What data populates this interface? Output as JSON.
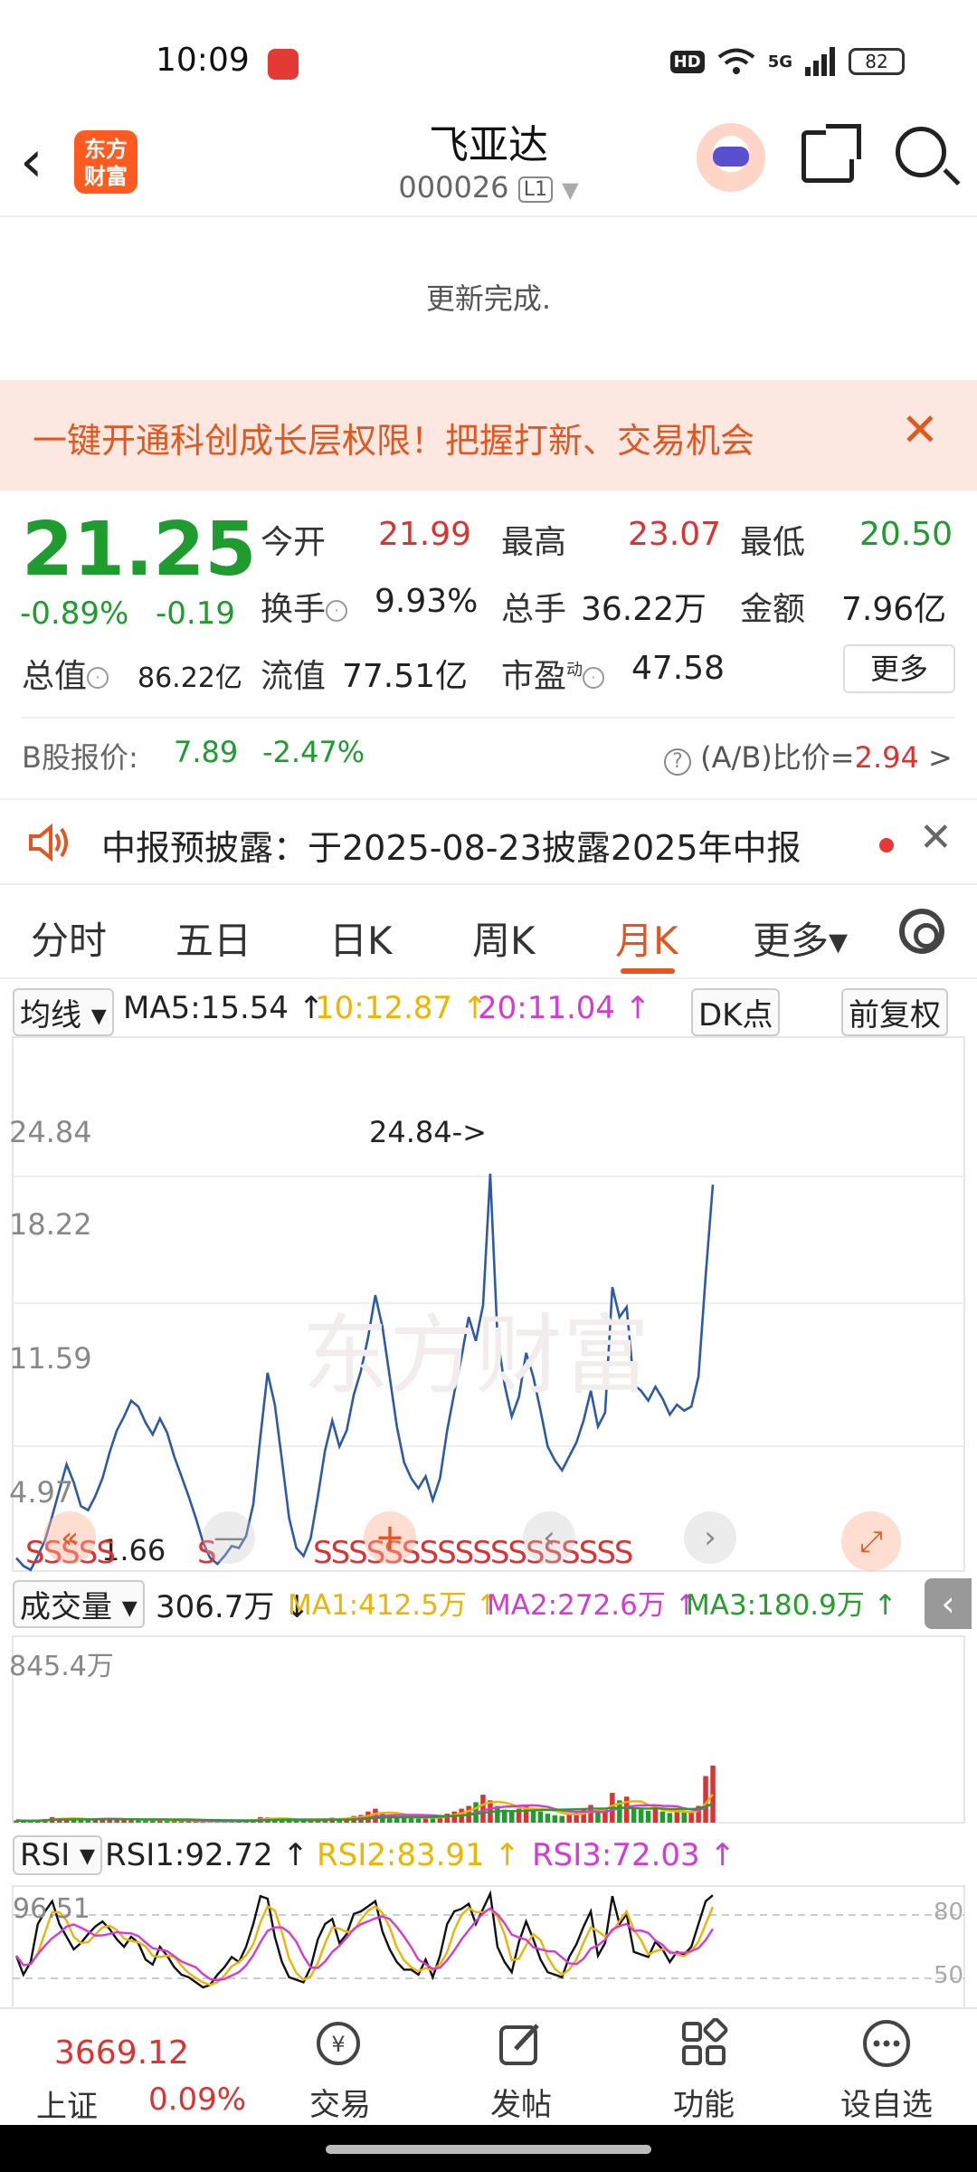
{
  "status": {
    "time": "10:09",
    "hd": "HD",
    "net": "5G",
    "battery": "82"
  },
  "header": {
    "logo_text": "东方\n财富",
    "name": "飞亚达",
    "code": "000026",
    "level": "L1"
  },
  "update_text": "更新完成.",
  "promo": {
    "text": "一键开通科创成长层权限！把握打新、交易机会"
  },
  "quote": {
    "price": "21.25",
    "change_pct": "-0.89%",
    "change": "-0.19",
    "open_label": "今开",
    "open": "21.99",
    "high_label": "最高",
    "high": "23.07",
    "low_label": "最低",
    "low": "20.50",
    "turnover_label": "换手",
    "turnover": "9.93%",
    "volume_label": "总手",
    "volume": "36.22万",
    "amount_label": "金额",
    "amount": "7.96亿",
    "mktcap_label": "总值",
    "mktcap": "86.22亿",
    "float_label": "流值",
    "float": "77.51亿",
    "pe_label": "市盈",
    "pe_sup": "动",
    "pe": "47.58",
    "more_label": "更多",
    "b_label": "B股报价:",
    "b_price": "7.89",
    "b_pct": "-2.47%",
    "ab_label": "(A/B)比价=",
    "ab_value": "2.94",
    "ab_arrow": ">"
  },
  "notice": {
    "text": "中报预披露：于2025-08-23披露2025年中报"
  },
  "tabs": [
    "分时",
    "五日",
    "日K",
    "周K",
    "月K",
    "更多▾"
  ],
  "active_tab": "月K",
  "ma": {
    "select": "均线 ▾",
    "ma5": "MA5:15.54",
    "ma10": "10:12.87",
    "ma20": "20:11.04",
    "dk": "DK点",
    "adjust": "前复权"
  },
  "volume_row": {
    "select": "成交量 ▾",
    "vol": "306.7万",
    "ma1": "MA1:412.5万",
    "ma2": "MA2:272.6万",
    "ma3": "MA3:180.9万"
  },
  "rsi_row": {
    "select": "RSI ▾",
    "rsi1": "RSI1:92.72",
    "rsi2": "RSI2:83.91",
    "rsi3": "RSI3:72.03"
  },
  "chart_data": {
    "type": "line",
    "price_axis_labels": [
      "24.84",
      "18.22",
      "11.59",
      "4.97"
    ],
    "price_axis_bottom": "1.66",
    "max_marker": "24.84->",
    "min_marker": "1.66",
    "volume_axis_label": "845.4万",
    "rsi_axis_labels": [
      "96.51",
      "80",
      "50"
    ],
    "watermark": "东方财富",
    "colors": {
      "price": "#2d5aa8",
      "up": "#e03131",
      "down": "#1e9c2e",
      "ma1": "#f0b400",
      "ma2": "#d63ad6",
      "ma3": "#22a02a",
      "rsi1": "#111111",
      "rsi2": "#f0b400",
      "rsi3": "#d63ad6"
    },
    "ylim": [
      1.66,
      24.84
    ],
    "close": [
      2.5,
      2.1,
      1.9,
      2.6,
      3.4,
      4.6,
      5.9,
      7.2,
      6.3,
      5.1,
      4.9,
      5.6,
      6.5,
      7.8,
      8.9,
      9.6,
      10.4,
      10.1,
      9.3,
      8.7,
      9.5,
      8.8,
      7.6,
      6.6,
      5.6,
      4.5,
      3.3,
      2.5,
      2.2,
      2.6,
      3.1,
      3.0,
      3.6,
      5.2,
      8.6,
      11.8,
      10.2,
      7.4,
      4.5,
      3.0,
      2.6,
      3.5,
      5.6,
      7.9,
      9.4,
      8.1,
      8.9,
      10.7,
      11.9,
      13.6,
      15.7,
      14.1,
      11.6,
      9.1,
      7.3,
      6.5,
      6.0,
      6.6,
      5.4,
      6.5,
      8.9,
      10.8,
      12.6,
      14.6,
      13.4,
      15.2,
      21.8,
      13.6,
      11.2,
      9.6,
      10.6,
      12.8,
      11.6,
      9.9,
      8.1,
      7.4,
      6.9,
      7.6,
      8.3,
      9.4,
      10.9,
      9.1,
      9.8,
      16.1,
      14.6,
      15.1,
      11.2,
      10.9,
      10.4,
      11.1,
      10.5,
      9.7,
      10.2,
      9.9,
      10.1,
      11.6,
      16.7,
      21.25
    ],
    "volume": [
      12,
      9,
      8,
      15,
      20,
      30,
      25,
      18,
      22,
      16,
      14,
      19,
      24,
      20,
      17,
      15,
      18,
      16,
      14,
      12,
      15,
      13,
      11,
      10,
      9,
      8,
      7,
      6,
      7,
      9,
      10,
      11,
      14,
      18,
      30,
      28,
      22,
      16,
      12,
      10,
      9,
      12,
      18,
      22,
      26,
      20,
      24,
      36,
      42,
      60,
      75,
      50,
      40,
      34,
      28,
      24,
      22,
      26,
      30,
      40,
      48,
      60,
      75,
      90,
      110,
      150,
      120,
      90,
      70,
      60,
      75,
      90,
      80,
      60,
      48,
      40,
      36,
      44,
      52,
      70,
      95,
      60,
      75,
      160,
      120,
      140,
      80,
      70,
      64,
      72,
      60,
      52,
      58,
      55,
      60,
      90,
      250,
      306.7
    ],
    "volume_max": 845.4,
    "rsi": [
      45,
      30,
      40,
      70,
      80,
      88,
      70,
      60,
      50,
      55,
      62,
      68,
      72,
      66,
      58,
      52,
      60,
      55,
      42,
      38,
      52,
      45,
      36,
      30,
      28,
      24,
      20,
      22,
      30,
      36,
      44,
      40,
      52,
      70,
      92,
      90,
      60,
      40,
      28,
      26,
      24,
      36,
      58,
      70,
      74,
      55,
      62,
      78,
      80,
      84,
      88,
      64,
      50,
      40,
      34,
      34,
      30,
      42,
      28,
      45,
      70,
      80,
      82,
      86,
      70,
      82,
      94,
      52,
      40,
      32,
      56,
      72,
      58,
      42,
      32,
      30,
      28,
      44,
      54,
      68,
      80,
      45,
      55,
      92,
      70,
      78,
      48,
      46,
      44,
      56,
      50,
      40,
      48,
      46,
      52,
      70,
      88,
      92.72
    ],
    "rsi_axis": [
      0,
      100
    ]
  },
  "bottom": {
    "index_value": "3669.12",
    "index_name": "上证",
    "index_pct": "0.09%",
    "items": [
      "交易",
      "发帖",
      "功能",
      "设自选"
    ]
  }
}
